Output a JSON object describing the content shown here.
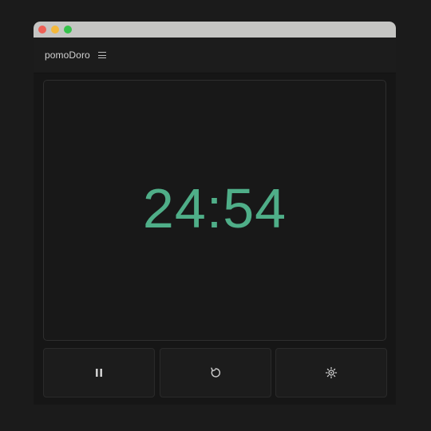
{
  "window": {
    "traffic_lights": [
      {
        "name": "close",
        "color": "#ee5f55"
      },
      {
        "name": "minimize",
        "color": "#f4b83a"
      },
      {
        "name": "maximize",
        "color": "#36c24b"
      }
    ]
  },
  "app": {
    "title": "pomoDoro",
    "menu_icon": "hamburger-menu-icon"
  },
  "timer": {
    "display": "24:54",
    "color": "#4fae88"
  },
  "controls": [
    {
      "name": "pause",
      "icon": "pause-icon"
    },
    {
      "name": "reset",
      "icon": "reset-icon"
    },
    {
      "name": "settings",
      "icon": "settings-icon"
    }
  ]
}
